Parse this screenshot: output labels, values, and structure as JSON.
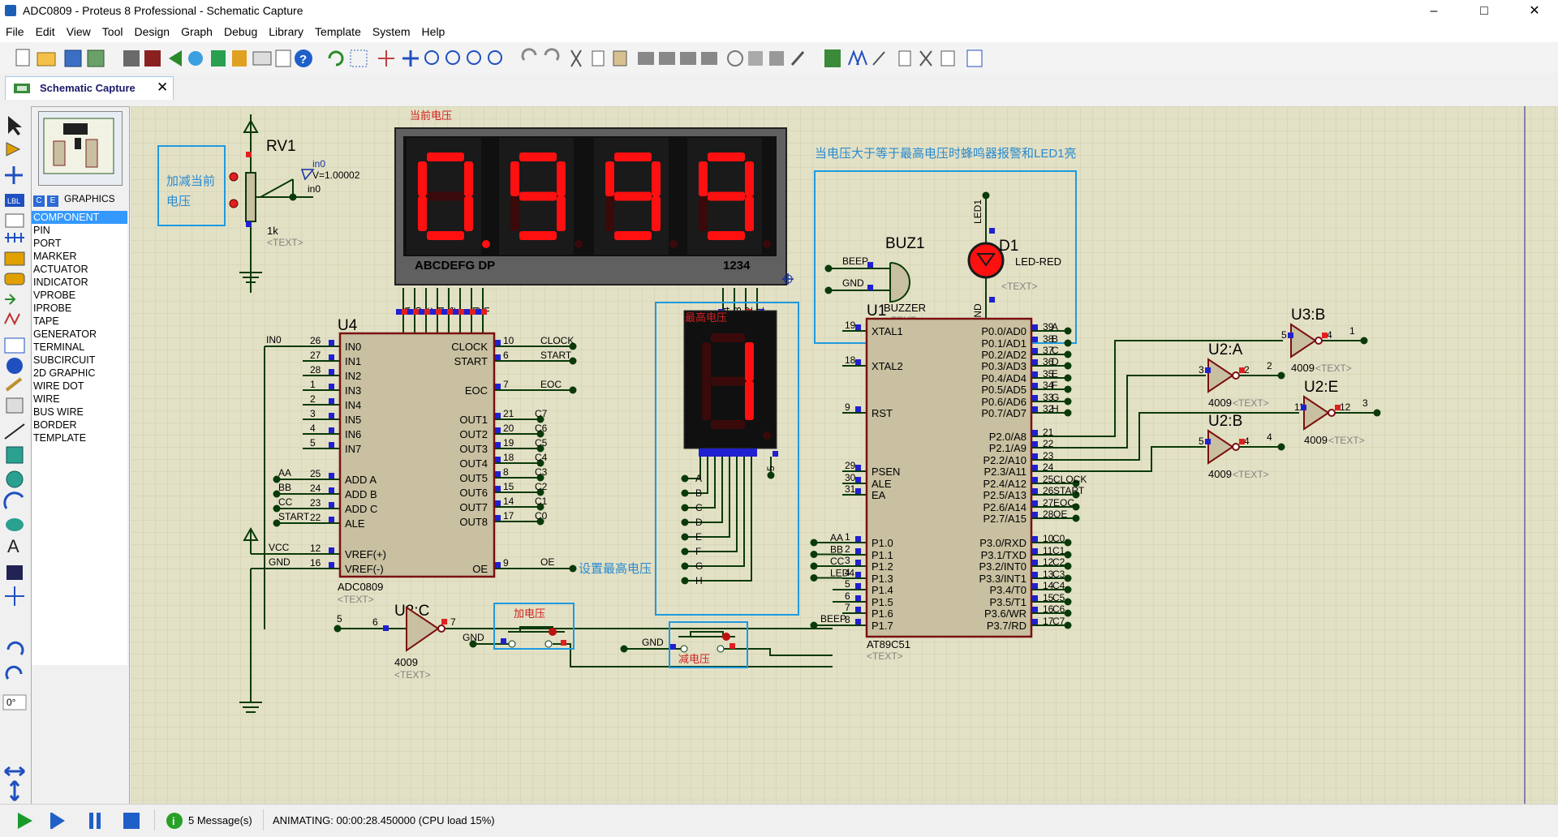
{
  "window": {
    "title": "ADC0809 - Proteus 8 Professional - Schematic Capture"
  },
  "menu": [
    "File",
    "Edit",
    "View",
    "Tool",
    "Design",
    "Graph",
    "Debug",
    "Library",
    "Template",
    "System",
    "Help"
  ],
  "tab": {
    "label": "Schematic Capture"
  },
  "panel": {
    "mode_label": "GRAPHICS",
    "modes": [
      "COMPONENT",
      "PIN",
      "PORT",
      "MARKER",
      "ACTUATOR",
      "INDICATOR",
      "VPROBE",
      "IPROBE",
      "TAPE",
      "GENERATOR",
      "TERMINAL",
      "SUBCIRCUIT",
      "2D GRAPHIC",
      "WIRE DOT",
      "WIRE",
      "BUS WIRE",
      "BORDER",
      "TEMPLATE"
    ],
    "selected_mode": "COMPONENT",
    "rotation": "0°"
  },
  "status": {
    "messages": "5 Message(s)",
    "animating": "ANIMATING: 00:00:28.450000 (CPU load 15%)"
  },
  "schematic": {
    "note_current": "当前电压",
    "note_alarm": "当电压大于等于最高电压时蜂鸣器报警和LED1亮",
    "note_adjust": "加减当前\n电压",
    "note_max": "最高电压",
    "note_set_max": "设置最高电压",
    "btn_add": "加电压",
    "btn_sub": "减电压",
    "rv1": {
      "ref": "RV1",
      "value": "1k",
      "probe": "in0",
      "probe_value": "V=1.00002",
      "text": "<TEXT>"
    },
    "display4": {
      "digits": [
        "0",
        "9",
        "9",
        "9"
      ],
      "seg_label": "ABCDEFG  DP",
      "dig_label": "1234"
    },
    "display1": {
      "digit": "1"
    },
    "buz1": {
      "ref": "BUZ1",
      "type": "BUZZER",
      "text": "<TEXT>",
      "net1": "BEEP",
      "net2": "GND"
    },
    "d1": {
      "ref": "D1",
      "type": "LED-RED",
      "text": "<TEXT>",
      "net_top": "LED1",
      "net_bottom": "GND"
    },
    "u4": {
      "ref": "U4",
      "part": "ADC0809",
      "text": "<TEXT>",
      "left_pins": [
        [
          "IN0",
          "26"
        ],
        [
          "IN1",
          "27"
        ],
        [
          "IN2",
          "28"
        ],
        [
          "IN3",
          "1"
        ],
        [
          "IN4",
          "2"
        ],
        [
          "IN5",
          "3"
        ],
        [
          "IN6",
          "4"
        ],
        [
          "IN7",
          "5"
        ],
        [
          "ADD A",
          "25"
        ],
        [
          "ADD B",
          "24"
        ],
        [
          "ADD C",
          "23"
        ],
        [
          "ALE",
          "22"
        ],
        [
          "VREF(+)",
          "12"
        ],
        [
          "VREF(-)",
          "16"
        ]
      ],
      "right_pins": [
        [
          "CLOCK",
          "10"
        ],
        [
          "START",
          "6"
        ],
        [
          "EOC",
          "7"
        ],
        [
          "OUT1",
          "21"
        ],
        [
          "OUT2",
          "20"
        ],
        [
          "OUT3",
          "19"
        ],
        [
          "OUT4",
          "18"
        ],
        [
          "OUT5",
          "8"
        ],
        [
          "OUT6",
          "15"
        ],
        [
          "OUT7",
          "14"
        ],
        [
          "OUT8",
          "17"
        ],
        [
          "OE",
          "9"
        ]
      ],
      "nets_left": [
        "IN0",
        "AA",
        "BB",
        "CC",
        "START",
        "VCC",
        "GND"
      ],
      "nets_right": [
        "CLOCK",
        "START",
        "EOC",
        "C7",
        "C6",
        "C5",
        "C4",
        "C3",
        "C2",
        "C1",
        "C0",
        "OE"
      ]
    },
    "u1": {
      "ref": "U1",
      "part": "AT89C51",
      "text": "<TEXT>",
      "left_pins": [
        [
          "XTAL1",
          "19"
        ],
        [
          "XTAL2",
          "18"
        ],
        [
          "RST",
          "9"
        ],
        [
          "PSEN",
          "29"
        ],
        [
          "ALE",
          "30"
        ],
        [
          "EA",
          "31"
        ],
        [
          "P1.0",
          "1"
        ],
        [
          "P1.1",
          "2"
        ],
        [
          "P1.2",
          "3"
        ],
        [
          "P1.3",
          "4"
        ],
        [
          "P1.4",
          "5"
        ],
        [
          "P1.5",
          "6"
        ],
        [
          "P1.6",
          "7"
        ],
        [
          "P1.7",
          "8"
        ]
      ],
      "right_pins": [
        [
          "P0.0/AD0",
          "39"
        ],
        [
          "P0.1/AD1",
          "38"
        ],
        [
          "P0.2/AD2",
          "37"
        ],
        [
          "P0.3/AD3",
          "36"
        ],
        [
          "P0.4/AD4",
          "35"
        ],
        [
          "P0.5/AD5",
          "34"
        ],
        [
          "P0.6/AD6",
          "33"
        ],
        [
          "P0.7/AD7",
          "32"
        ],
        [
          "P2.0/A8",
          "21"
        ],
        [
          "P2.1/A9",
          "22"
        ],
        [
          "P2.2/A10",
          "23"
        ],
        [
          "P2.3/A11",
          "24"
        ],
        [
          "P2.4/A12",
          "25"
        ],
        [
          "P2.5/A13",
          "26"
        ],
        [
          "P2.6/A14",
          "27"
        ],
        [
          "P2.7/A15",
          "28"
        ],
        [
          "P3.0/RXD",
          "10"
        ],
        [
          "P3.1/TXD",
          "11"
        ],
        [
          "P3.2/INT0",
          "12"
        ],
        [
          "P3.3/INT1",
          "13"
        ],
        [
          "P3.4/T0",
          "14"
        ],
        [
          "P3.5/T1",
          "15"
        ],
        [
          "P3.6/WR",
          "16"
        ],
        [
          "P3.7/RD",
          "17"
        ]
      ],
      "nets_p0": [
        "A",
        "B",
        "C",
        "D",
        "E",
        "F",
        "G",
        "H"
      ],
      "nets_p1": [
        "AA",
        "BB",
        "CC",
        "LED4"
      ],
      "nets_p2": [
        "CLOCK",
        "START",
        "EOC",
        "OE"
      ],
      "nets_p3": [
        "C0",
        "C1",
        "C2",
        "C3",
        "C4",
        "C5",
        "C6",
        "C7"
      ],
      "net_p17": "BEEP"
    },
    "gates": [
      {
        "ref": "U3:B",
        "part": "4009",
        "in": "5",
        "out": "4",
        "outnet": "1"
      },
      {
        "ref": "U2:A",
        "part": "4009",
        "in": "3",
        "out": "2",
        "outnet": "2"
      },
      {
        "ref": "U2:E",
        "part": "4009",
        "in": "11",
        "out": "12",
        "outnet": "3"
      },
      {
        "ref": "U2:B",
        "part": "4009",
        "in": "5",
        "out": "4",
        "outnet": "4"
      },
      {
        "ref": "U2:C",
        "part": "4009",
        "in": "6",
        "out": "7",
        "innet": "5"
      }
    ],
    "seg_pins": [
      "a",
      "b",
      "c",
      "d",
      "e",
      "f",
      "g",
      "h"
    ],
    "dig_pins": [
      "4",
      "3",
      "2",
      "1"
    ],
    "max_pins": [
      "A",
      "B",
      "C",
      "D",
      "E",
      "F",
      "G",
      "H"
    ],
    "gnd": "GND"
  }
}
